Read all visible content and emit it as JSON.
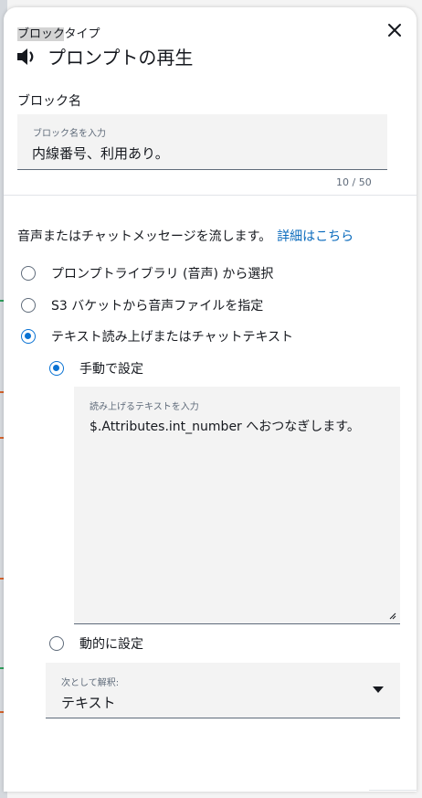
{
  "header": {
    "block_type_prefix": "ブロック",
    "block_type_suffix": "タイプ",
    "title": "プロンプトの再生"
  },
  "block_name": {
    "label": "ブロック名",
    "placeholder": "ブロック名を入力",
    "value": "内線番号、利用あり。",
    "counter": "10 / 50"
  },
  "description": {
    "text": "音声またはチャットメッセージを流します。",
    "link": "詳細はこちら"
  },
  "source_options": [
    {
      "label": "プロンプトライブラリ (音声) から選択",
      "selected": false
    },
    {
      "label": "S3 バケットから音声ファイルを指定",
      "selected": false
    },
    {
      "label": "テキスト読み上げまたはチャットテキスト",
      "selected": true
    }
  ],
  "text_mode": {
    "manual_label": "手動で設定",
    "manual_selected": true,
    "textarea_placeholder": "読み上げるテキストを入力",
    "textarea_value": "$.Attributes.int_number へおつなぎします。",
    "dynamic_label": "動的に設定",
    "dynamic_selected": false
  },
  "interpret_as": {
    "label": "次として解釈:",
    "value": "テキスト"
  },
  "icons": {
    "close": "close-icon",
    "speaker": "speaker-icon",
    "caret": "caret-down-icon",
    "resize": "resize-handle-icon"
  },
  "colors": {
    "accent": "#0972d3",
    "link": "#0b6bbd",
    "field_bg": "#f3f3f3"
  }
}
